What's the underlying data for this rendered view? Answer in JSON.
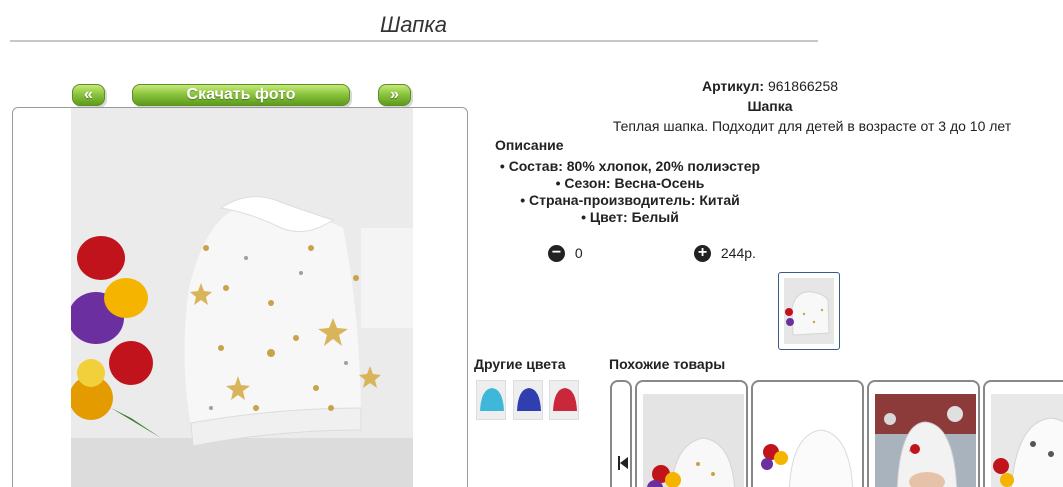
{
  "page": {
    "title": "Шапка"
  },
  "gallery": {
    "prev_label": "«",
    "download_label": "Скачать фото",
    "next_label": "»"
  },
  "product": {
    "article_label": "Артикул:",
    "article_value": "961866258",
    "name": "Шапка",
    "short_description": "Теплая шапка. Подходит для детей в возрасте от 3 до 10 лет",
    "description_heading": "Описание",
    "specs": [
      "Состав: 80% хлопок, 20% полиэстер",
      "Сезон: Весна-Осень",
      "Страна-производитель: Китай",
      "Цвет: Белый"
    ]
  },
  "quantity": {
    "minus_icon": "minus-circle-icon",
    "value": "0",
    "plus_icon": "plus-circle-icon",
    "price": "244р."
  },
  "colors": {
    "other_colors_label": "Другие цвета",
    "swatches": [
      "#3fb7d8",
      "#2f3fb0",
      "#c8283a"
    ]
  },
  "similar": {
    "label": "Похожие товары",
    "prev_icon": "skip-back-icon",
    "cards": 4
  }
}
